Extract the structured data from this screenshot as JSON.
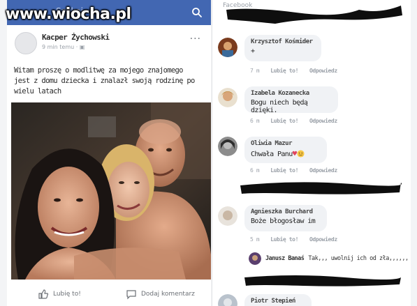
{
  "watermark": "www.wiocha.pl",
  "post": {
    "author": "Kacper Żychowski",
    "meta_time": "9 min temu",
    "text_line1": "Witam proszę o modlitwę za mojego znajomego",
    "text_line2": "jest z domu dziecka i znalazł swoją rodzinę po",
    "text_line3": "wielu latach",
    "like_label": "Lubię to!",
    "comment_label": "Dodaj komentarz",
    "more": "···"
  },
  "comments_panel": {
    "top_label": "Facebook",
    "like_label": "Lubię to!",
    "reply_label": "Odpowiedz",
    "comments": [
      {
        "name": "Krzysztof Kośmider",
        "text": "+",
        "time": "7 m"
      },
      {
        "name": "Izabela Kozanecka",
        "text": "Bogu niech będą dzięki.",
        "time": "6 m"
      },
      {
        "name": "Oliwia Mazur",
        "text": "Chwała Panu",
        "time": "6 m"
      },
      {
        "name": "Agnieszka Burchard",
        "text": "Boże błogosław im",
        "time": "5 m"
      }
    ],
    "reply": {
      "name": "Janusz Banaś",
      "text": "Tak,,, uwolnij ich od zła,,,,,,"
    },
    "last_name": "Piotr Stepień"
  },
  "colors": {
    "fb_blue": "#4267b2",
    "bubble": "#f0f2f5"
  }
}
